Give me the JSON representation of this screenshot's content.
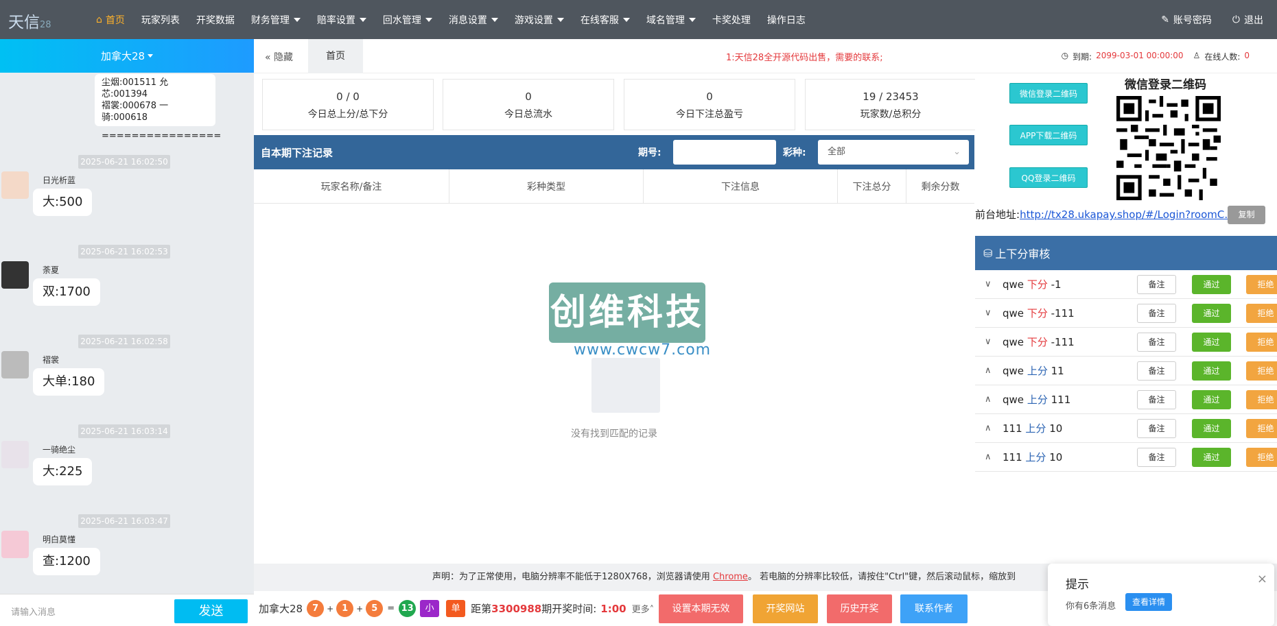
{
  "app": {
    "logo": "天信",
    "logo_sub": "28"
  },
  "nav": {
    "items": [
      {
        "label": "首页"
      },
      {
        "label": "玩家列表"
      },
      {
        "label": "开奖数据"
      },
      {
        "label": "财务管理"
      },
      {
        "label": "赔率设置"
      },
      {
        "label": "回水管理"
      },
      {
        "label": "消息设置"
      },
      {
        "label": "游戏设置"
      },
      {
        "label": "在线客服"
      },
      {
        "label": "域名管理"
      },
      {
        "label": "卡奖处理"
      },
      {
        "label": "操作日志"
      }
    ],
    "account": "账号密码",
    "logout": "退出"
  },
  "room": {
    "name": "加拿大28"
  },
  "chat": {
    "top_msg_l1": "尘烟:001511 允芯:001394",
    "top_msg_l2": "褶裳:000678 一骑:000618",
    "top_msg_l3": "================",
    "messages": [
      {
        "time": "2025-06-21 16:02:50",
        "user": "日光析蓝",
        "text": "大:500"
      },
      {
        "time": "2025-06-21 16:02:53",
        "user": "荼夏",
        "text": "双:1700"
      },
      {
        "time": "2025-06-21 16:02:58",
        "user": "褶裳",
        "text": "大单:180"
      },
      {
        "time": "2025-06-21 16:03:14",
        "user": "一骑绝尘",
        "text": "大:225"
      },
      {
        "time": "2025-06-21 16:03:47",
        "user": "明白莫懂",
        "text": "查:1200"
      }
    ],
    "input_placeholder": "请输入消息",
    "send": "发送"
  },
  "tabs": {
    "hide": "隐藏",
    "home": "首页"
  },
  "notice": "1:天信28全开源代码出售，需要的联系;",
  "expire": {
    "label": "到期:",
    "date": "2099-03-01 00:00:00",
    "online_label": "在线人数:",
    "online": "0"
  },
  "stats": [
    {
      "value": "0 / 0",
      "label": "今日总上分/总下分"
    },
    {
      "value": "0",
      "label": "今日总流水"
    },
    {
      "value": "0",
      "label": "今日下注总盈亏"
    },
    {
      "value": "19 / 23453",
      "label": "玩家数/总积分"
    }
  ],
  "bets": {
    "title": "自本期下注记录",
    "period_label": "期号:",
    "period_value": "",
    "type_label": "彩种:",
    "type_value": "全部",
    "columns": [
      "玩家名称/备注",
      "彩种类型",
      "下注信息",
      "下注总分",
      "剩余分数"
    ],
    "empty": "没有找到匹配的记录",
    "watermark": "创维科技",
    "watermark_url": "www.cwcw7.com"
  },
  "side": {
    "btn_wechat": "微信登录二维码",
    "btn_app": "APP下载二维码",
    "btn_qq": "QQ登录二维码",
    "qr_title": "微信登录二维码",
    "addr_label": "前台地址:",
    "addr_url": "http://tx28.ukapay.shop/#/Login?roomC...",
    "copy": "复制"
  },
  "audit": {
    "title": "上下分审核",
    "rows": [
      {
        "chev": "∨",
        "user": "qwe",
        "type": "下分",
        "amount": "-1",
        "kind": "down"
      },
      {
        "chev": "∨",
        "user": "qwe",
        "type": "下分",
        "amount": "-111",
        "kind": "down"
      },
      {
        "chev": "∨",
        "user": "qwe",
        "type": "下分",
        "amount": "-111",
        "kind": "down"
      },
      {
        "chev": "∧",
        "user": "qwe",
        "type": "上分",
        "amount": "11",
        "kind": "up"
      },
      {
        "chev": "∧",
        "user": "qwe",
        "type": "上分",
        "amount": "111",
        "kind": "up"
      },
      {
        "chev": "∧",
        "user": "111",
        "type": "上分",
        "amount": "10",
        "kind": "up"
      },
      {
        "chev": "∧",
        "user": "111",
        "type": "上分",
        "amount": "10",
        "kind": "up"
      }
    ],
    "note": "备注",
    "pass": "通过",
    "reject": "拒绝"
  },
  "declaration": {
    "pre": "声明：为了正常使用，电脑分辨率不能低于1280X768，浏览器请使用 ",
    "link": "Chrome",
    "post": "。 若电脑的分辨率比较低，请按住\"Ctrl\"键，然后滚动鼠标，缩放到"
  },
  "lottery": {
    "name": "加拿大28",
    "n1": "7",
    "n2": "1",
    "n3": "5",
    "sum": "13",
    "plus": "+",
    "eq": "=",
    "size": "小",
    "parity": "单",
    "pre": "距第",
    "period": "3300988",
    "mid": "期开奖时间:",
    "time": "1:00",
    "more": "更多"
  },
  "actions": {
    "invalid": "设置本期无效",
    "site": "开奖网站",
    "history": "历史开奖",
    "contact": "联系作者"
  },
  "toast": {
    "title": "提示",
    "msg": "你有6条消息",
    "btn": "查看详情",
    "close": "×"
  },
  "colors": {
    "nav_active": "#ffb22a",
    "header_blue": "#336699",
    "pass_green": "#5bb52b",
    "reject_orange": "#f2a540",
    "red": "#e4393c"
  }
}
